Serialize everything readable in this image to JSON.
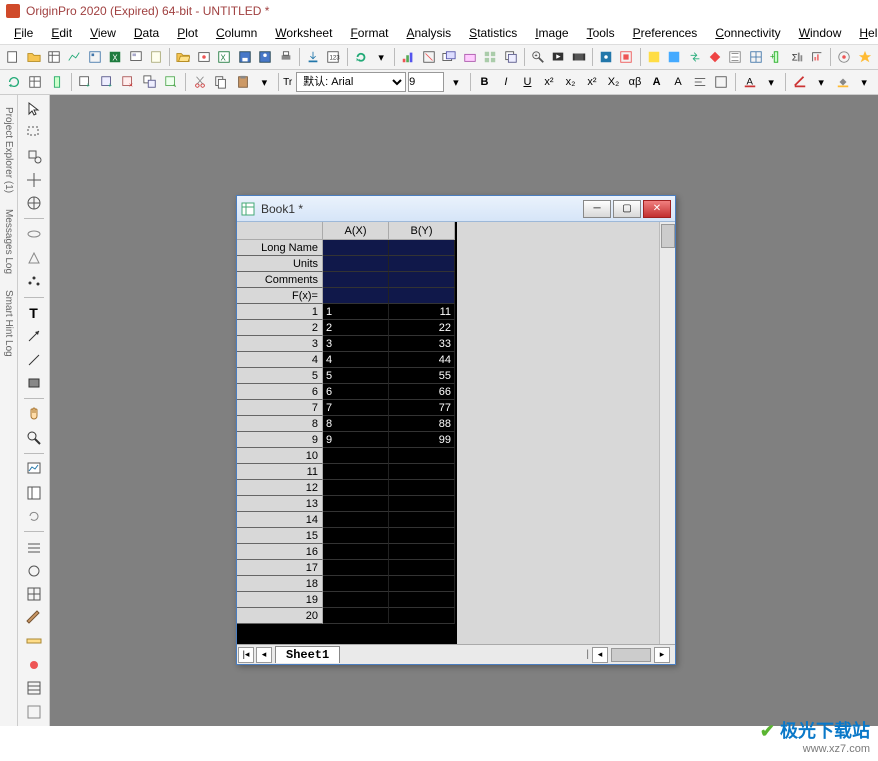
{
  "app_title": "OriginPro 2020 (Expired) 64-bit - UNTITLED *",
  "menus": [
    "File",
    "Edit",
    "View",
    "Data",
    "Plot",
    "Column",
    "Worksheet",
    "Format",
    "Analysis",
    "Statistics",
    "Image",
    "Tools",
    "Preferences",
    "Connectivity",
    "Window",
    "Help"
  ],
  "font": {
    "name": "默认: Arial",
    "prefix": "Tr",
    "size": "9"
  },
  "format_buttons": {
    "bold": "B",
    "italic": "I",
    "underline": "U",
    "sup": "x²",
    "sub": "x₂",
    "sup2": "x²",
    "sub2": "X₂",
    "greek": "αβ",
    "abig": "A",
    "abig2": "A"
  },
  "side_tabs": [
    "Project Explorer (1)",
    "Messages Log",
    "Smart Hint Log"
  ],
  "book": {
    "title": "Book1 *",
    "columns": [
      "A(X)",
      "B(Y)"
    ],
    "header_rows": [
      "Long Name",
      "Units",
      "Comments",
      "F(x)="
    ],
    "sheet_tab": "Sheet1",
    "rows": [
      {
        "n": "1",
        "a": "1",
        "b": "11"
      },
      {
        "n": "2",
        "a": "2",
        "b": "22"
      },
      {
        "n": "3",
        "a": "3",
        "b": "33"
      },
      {
        "n": "4",
        "a": "4",
        "b": "44"
      },
      {
        "n": "5",
        "a": "5",
        "b": "55"
      },
      {
        "n": "6",
        "a": "6",
        "b": "66"
      },
      {
        "n": "7",
        "a": "7",
        "b": "77"
      },
      {
        "n": "8",
        "a": "8",
        "b": "88"
      },
      {
        "n": "9",
        "a": "9",
        "b": "99"
      },
      {
        "n": "10",
        "a": "",
        "b": ""
      },
      {
        "n": "11",
        "a": "",
        "b": ""
      },
      {
        "n": "12",
        "a": "",
        "b": ""
      },
      {
        "n": "13",
        "a": "",
        "b": ""
      },
      {
        "n": "14",
        "a": "",
        "b": ""
      },
      {
        "n": "15",
        "a": "",
        "b": ""
      },
      {
        "n": "16",
        "a": "",
        "b": ""
      },
      {
        "n": "17",
        "a": "",
        "b": ""
      },
      {
        "n": "18",
        "a": "",
        "b": ""
      },
      {
        "n": "19",
        "a": "",
        "b": ""
      },
      {
        "n": "20",
        "a": "",
        "b": ""
      }
    ]
  },
  "watermark": {
    "brand_cn": "极光下载站",
    "url": "www.xz7.com"
  },
  "chart_data": {
    "type": "table",
    "columns": [
      "A(X)",
      "B(Y)"
    ],
    "data": [
      [
        1,
        11
      ],
      [
        2,
        22
      ],
      [
        3,
        33
      ],
      [
        4,
        44
      ],
      [
        5,
        55
      ],
      [
        6,
        66
      ],
      [
        7,
        77
      ],
      [
        8,
        88
      ],
      [
        9,
        99
      ]
    ]
  }
}
